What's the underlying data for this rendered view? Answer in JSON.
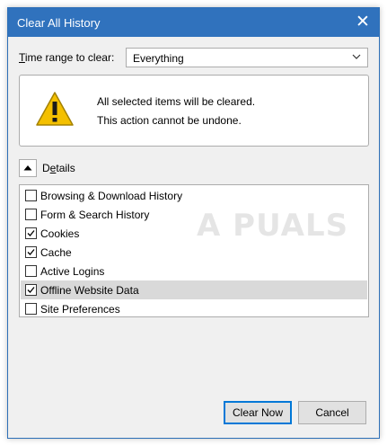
{
  "window": {
    "title": "Clear All History"
  },
  "time_range": {
    "label_prefix": "",
    "label_underlined": "T",
    "label_rest": "ime range to clear:",
    "selected": "Everything"
  },
  "warning": {
    "line1": "All selected items will be cleared.",
    "line2": "This action cannot be undone."
  },
  "details": {
    "label_prefix": "D",
    "label_underlined": "e",
    "label_rest": "tails"
  },
  "items": [
    {
      "label": "Browsing & Download History",
      "checked": false,
      "selected": false
    },
    {
      "label": "Form & Search History",
      "checked": false,
      "selected": false
    },
    {
      "label": "Cookies",
      "checked": true,
      "selected": false
    },
    {
      "label": "Cache",
      "checked": true,
      "selected": false
    },
    {
      "label": "Active Logins",
      "checked": false,
      "selected": false
    },
    {
      "label": "Offline Website Data",
      "checked": true,
      "selected": true
    },
    {
      "label": "Site Preferences",
      "checked": false,
      "selected": false
    }
  ],
  "buttons": {
    "clear_now": "Clear Now",
    "cancel": "Cancel"
  },
  "watermark": "A  PUALS",
  "colors": {
    "titlebar": "#3072bd",
    "primary_border": "#0078d7",
    "warning": "#f4c000"
  }
}
